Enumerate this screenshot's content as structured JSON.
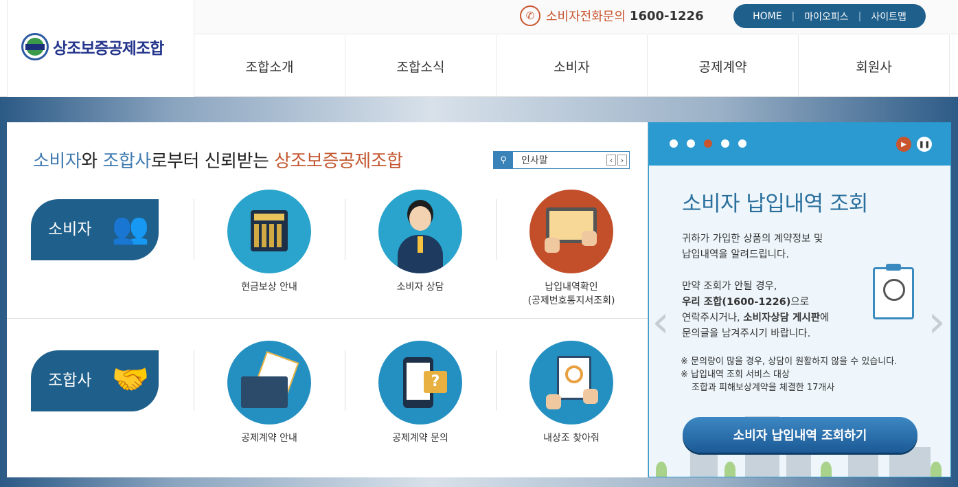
{
  "header": {
    "logo_text": "상조보증공제조합",
    "phone_label": "소비자전화문의",
    "phone_number": "1600-1226",
    "top_links": [
      "HOME",
      "마이오피스",
      "사이트맵"
    ],
    "nav": [
      "조합소개",
      "조합소식",
      "소비자",
      "공제계약",
      "회원사"
    ]
  },
  "main": {
    "headline": {
      "part1": "소비자",
      "part2": "와 ",
      "part3": "조합사",
      "part4": "로부터 신뢰받는 ",
      "part5": "상조보증공제조합"
    },
    "search": {
      "value": "인사말",
      "prev": "‹",
      "next": "›"
    },
    "consumer_row": {
      "label": "소비자",
      "services": [
        {
          "label": "현금보상 안내"
        },
        {
          "label": "소비자 상담"
        },
        {
          "label": "납입내역확인",
          "sub": "(공제번호통지서조회)"
        }
      ]
    },
    "member_row": {
      "label": "조합사",
      "services": [
        {
          "label": "공제계약 안내"
        },
        {
          "label": "공제계약 문의"
        },
        {
          "label": "내상조 찾아줘"
        }
      ]
    }
  },
  "slider": {
    "dots": 5,
    "active_dot": 3,
    "title": "소비자 납입내역 조회",
    "para1_line1": "귀하가 가입한 상품의 계약정보 및",
    "para1_line2": "납입내역을 알려드립니다.",
    "para2_line1": "만약 조회가 안될 경우,",
    "para2_line2_bold": "우리 조합(1600-1226)",
    "para2_line2_rest": "으로",
    "para2_line3_pre": "연락주시거나, ",
    "para2_line3_bold": "소비자상담 게시판",
    "para2_line3_post": "에",
    "para2_line4": "문의글을 남겨주시기 바랍니다.",
    "note1": "※ 문의량이 많을 경우, 상담이 원활하지 않을 수 있습니다.",
    "note2": "※ 납입내역 조회 서비스 대상",
    "note3": "조합과 피해보상계약을 체결한 17개사",
    "cta": "소비자 납입내역 조회하기"
  },
  "colors": {
    "brand_blue": "#1f5f8b",
    "accent_red": "#c9552f",
    "slider_blue": "#2a9ad0"
  }
}
